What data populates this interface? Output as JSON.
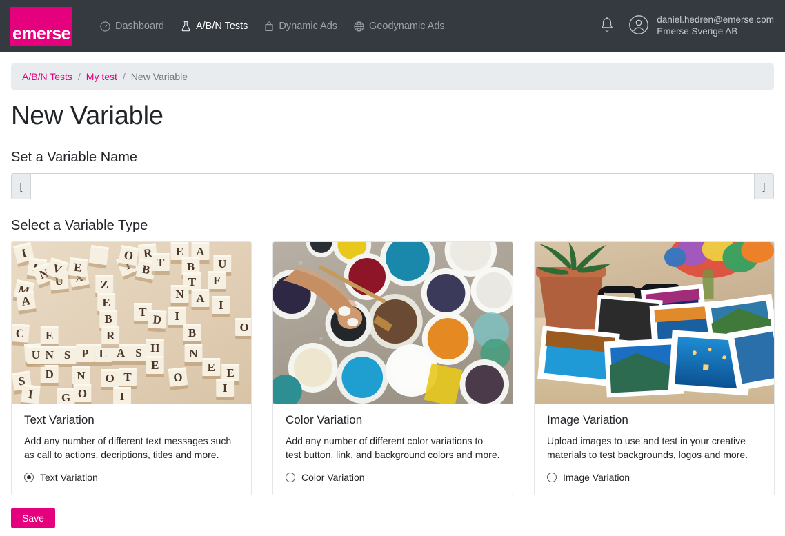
{
  "brand": {
    "logo_text": "emerse",
    "accent_color": "#e5007d",
    "topbar_color": "#343a40"
  },
  "nav": {
    "items": [
      {
        "label": "Dashboard",
        "icon": "gauge-icon",
        "active": false
      },
      {
        "label": "A/B/N Tests",
        "icon": "flask-icon",
        "active": true
      },
      {
        "label": "Dynamic Ads",
        "icon": "bag-icon",
        "active": false
      },
      {
        "label": "Geodynamic Ads",
        "icon": "globe-icon",
        "active": false
      }
    ]
  },
  "user": {
    "email": "daniel.hedren@emerse.com",
    "organization": "Emerse Sverige AB",
    "bell_icon": "bell-icon",
    "avatar_icon": "user-circle-icon"
  },
  "breadcrumb": {
    "items": [
      {
        "label": "A/B/N Tests",
        "link": true
      },
      {
        "label": "My test",
        "link": true
      },
      {
        "label": "New Variable",
        "link": false
      }
    ],
    "separator": "/"
  },
  "page": {
    "title": "New Variable",
    "name_section_label": "Set a Variable Name",
    "type_section_label": "Select a Variable Type"
  },
  "variable_name_input": {
    "prefix": "[",
    "suffix": "]",
    "value": "",
    "placeholder": ""
  },
  "variable_types": [
    {
      "title": "Text Variation",
      "description": "Add any number of different text messages such as call to actions, decriptions, titles and more.",
      "radio_label": "Text Variation",
      "selected": true,
      "image": "scrabble-tiles-photo"
    },
    {
      "title": "Color Variation",
      "description": "Add any number of different color variations to test button, link, and background colors and more.",
      "radio_label": "Color Variation",
      "selected": false,
      "image": "paint-buckets-photo"
    },
    {
      "title": "Image Variation",
      "description": "Upload images to use and test in your creative materials to test backgrounds, logos and more.",
      "radio_label": "Image Variation",
      "selected": false,
      "image": "photos-on-desk-photo"
    }
  ],
  "actions": {
    "save_label": "Save"
  }
}
